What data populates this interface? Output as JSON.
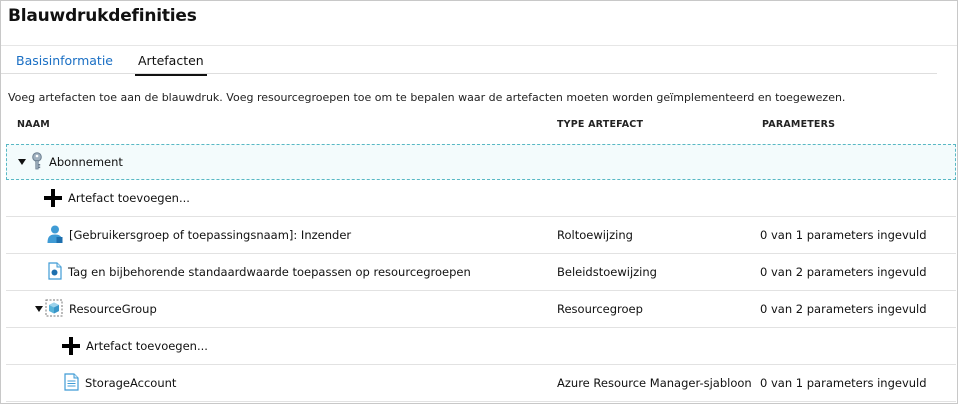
{
  "header": {
    "title": "Blauwdrukdefinities"
  },
  "tabs": [
    {
      "label": "Basisinformatie"
    },
    {
      "label": "Artefacten"
    }
  ],
  "description": "Voeg artefacten toe aan de blauwdruk. Voeg resourcegroepen toe om te bepalen waar de artefacten moeten worden geïmplementeerd en toegewezen.",
  "columns": {
    "name": "NAAM",
    "type": "TYPE ARTEFACT",
    "parameters": "PARAMETERS"
  },
  "rows": {
    "subscription": {
      "label": "Abonnement",
      "icon": "key-icon"
    },
    "add1": {
      "label": "Artefact toevoegen...",
      "icon": "plus-icon"
    },
    "role": {
      "label": "[Gebruikersgroep of toepassingsnaam]: Inzender",
      "type": "Roltoewijzing",
      "params": "0 van 1 parameters ingevuld",
      "icon": "user-icon"
    },
    "policy": {
      "label": "Tag en bijbehorende standaardwaarde toepassen op resourcegroepen",
      "type": "Beleidstoewijzing",
      "params": "0 van 2 parameters ingevuld",
      "icon": "policy-icon"
    },
    "rg": {
      "label": "ResourceGroup",
      "type": "Resourcegroep",
      "params": "0 van 2 parameters ingevuld",
      "icon": "resource-group-icon"
    },
    "add2": {
      "label": "Artefact toevoegen...",
      "icon": "plus-icon"
    },
    "storage": {
      "label": "StorageAccount",
      "type": "Azure Resource Manager-sjabloon",
      "params": "0 van 1 parameters ingevuld",
      "icon": "template-icon"
    }
  },
  "colors": {
    "accent": "#1a6fc4",
    "selection_border": "#58b8c4"
  }
}
